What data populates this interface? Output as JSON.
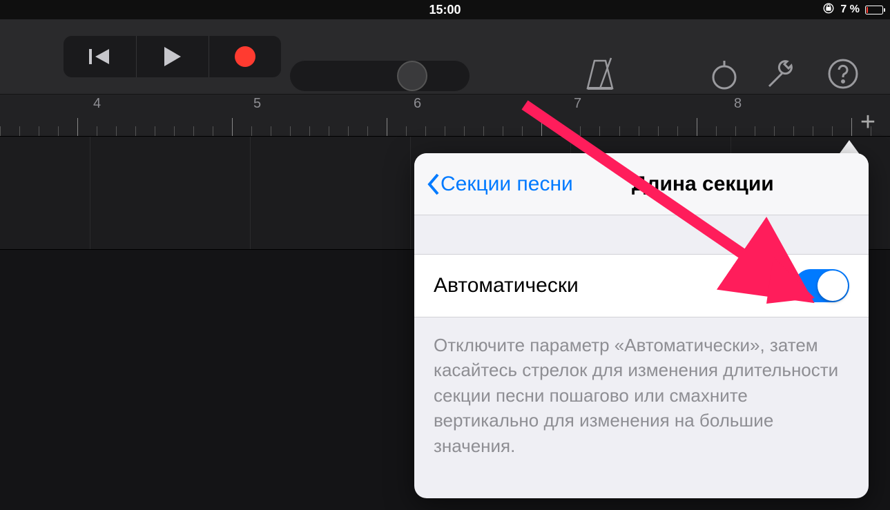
{
  "statusbar": {
    "time": "15:00",
    "battery_percent": "7 %",
    "lock_rotation_icon": "rotation-lock-icon"
  },
  "toolbar": {
    "rewind_icon": "rewind-icon",
    "play_icon": "play-icon",
    "record_icon": "record-icon",
    "metronome_icon": "metronome-icon",
    "loop_icon": "loop-icon",
    "settings_icon": "wrench-icon",
    "help_icon": "help-icon"
  },
  "ruler": {
    "bars": [
      "4",
      "5",
      "6",
      "7",
      "8"
    ],
    "add_icon": "plus-icon"
  },
  "popover": {
    "back_label": "Секции песни",
    "title": "Длина секции",
    "auto_label": "Автоматически",
    "auto_on": true,
    "description": "Отключите параметр «Автоматически», затем касайтесь стрелок для изменения длительности секции песни пошагово или смахните вертикально для изменения на большие значения."
  },
  "colors": {
    "accent": "#007aff",
    "record": "#ff3b30",
    "annotation": "#ff1d5b"
  }
}
